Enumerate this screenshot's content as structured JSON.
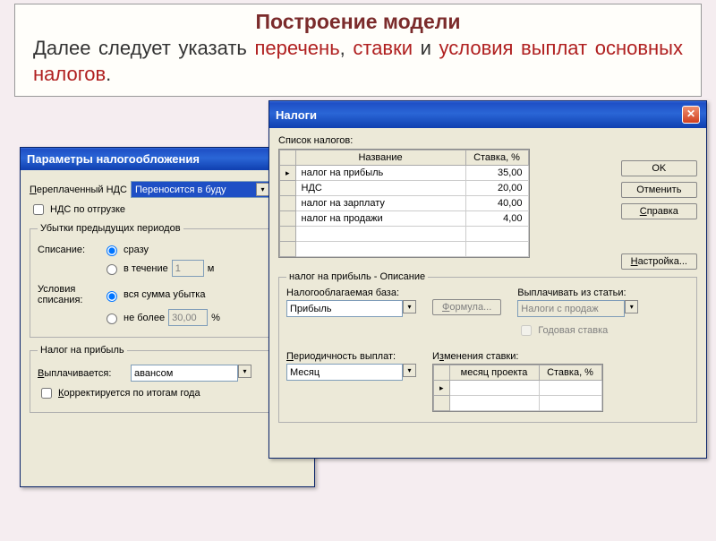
{
  "slide": {
    "title": "Построение модели",
    "text_prefix": "Далее следует указать ",
    "hl1": "перечень",
    "sep1": ", ",
    "hl2": "ставки",
    "sep2": " и ",
    "hl3": "условия выплат основных налогов",
    "dot": "."
  },
  "win1": {
    "title": "Параметры налогообложения",
    "overpaid_label": "Переплаченный НДС",
    "overpaid_value": "Переносится в буду",
    "vat_ship": "НДС по отгрузке",
    "losses_legend": "Убытки предыдущих периодов",
    "writeoff": "Списание:",
    "opt_now": "сразу",
    "opt_over": "в течение",
    "opt_over_val": "1",
    "opt_over_unit": "м",
    "cond": "Условия списания:",
    "opt_all": "вся сумма убытка",
    "opt_max": "не более",
    "opt_max_val": "30,00",
    "opt_max_unit": "%",
    "profit_legend": "Налог на прибыль",
    "paid_label": "Выплачивается:",
    "paid_value": "авансом",
    "adjust": "Корректируется по итогам года"
  },
  "win2": {
    "title": "Налоги",
    "list_label": "Список налогов:",
    "col_name": "Название",
    "col_rate": "Ставка, %",
    "rows": [
      {
        "name": "налог на прибыль",
        "rate": "35,00"
      },
      {
        "name": "НДС",
        "rate": "20,00"
      },
      {
        "name": "налог на зарплату",
        "rate": "40,00"
      },
      {
        "name": "налог на продажи",
        "rate": "4,00"
      }
    ],
    "btn_ok": "OK",
    "btn_cancel": "Отменить",
    "btn_help": "Справка",
    "btn_setup": "Настройка...",
    "desc_legend": "налог на прибыль - Описание",
    "base_label": "Налогооблагаемая база:",
    "base_value": "Прибыль",
    "formula": "Формула...",
    "pay_from": "Выплачивать из статьи:",
    "pay_from_value": "Налоги с продаж",
    "annual": "Годовая ставка",
    "period_label": "Периодичность выплат:",
    "period_value": "Месяц",
    "changes_label": "Изменения ставки:",
    "col_month": "месяц проекта",
    "col_rate2": "Ставка, %"
  }
}
